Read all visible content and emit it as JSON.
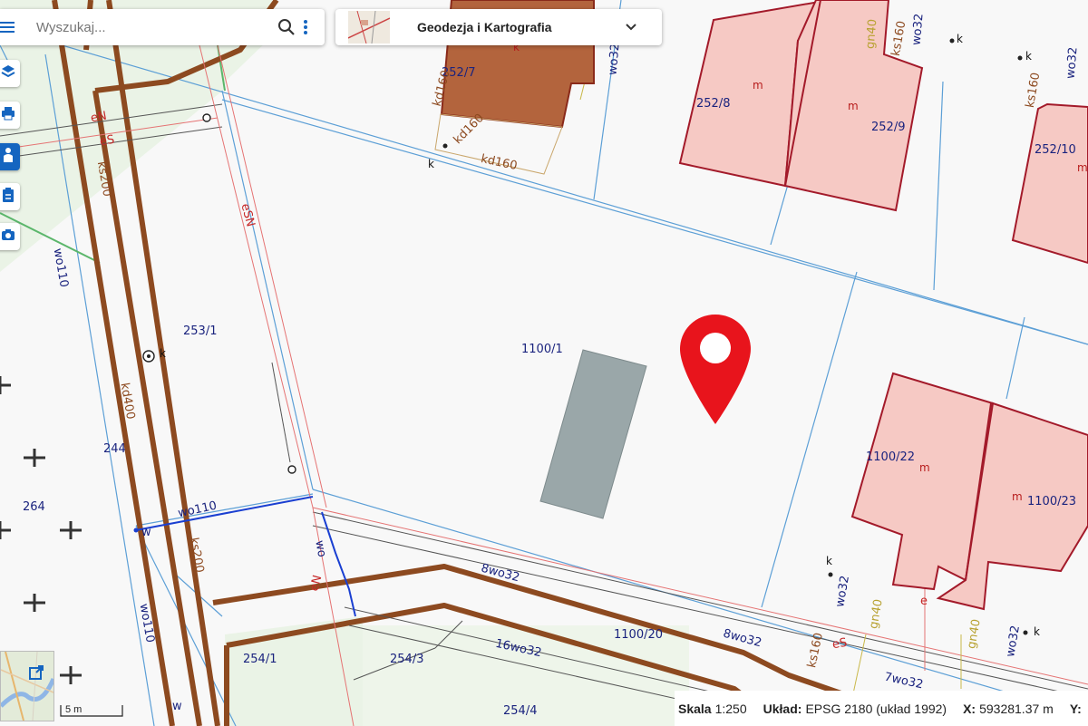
{
  "search": {
    "placeholder": "Wyszukaj..."
  },
  "layer": {
    "title": "Geodezja i Kartografia"
  },
  "status_bar": {
    "scale_label": "Skala",
    "scale_value": "1:250",
    "crs_label": "Układ:",
    "crs_value": "EPSG 2180 (układ 1992)",
    "x_label": "X:",
    "x_value": "593281.37 m",
    "y_label": "Y:"
  },
  "scale_bar": {
    "label": "5 m"
  },
  "map": {
    "parcels": [
      "252/7",
      "252/8",
      "252/9",
      "252/10",
      "253/1",
      "1100/1",
      "244",
      "264",
      "1100/22",
      "1100/23",
      "1100/20",
      "254/1",
      "254/3",
      "254/4"
    ],
    "building_codes": [
      "k",
      "m",
      "m",
      "m",
      "m",
      "m"
    ],
    "utility_labels": [
      "kd160",
      "kd160",
      "kd160",
      "ks160",
      "ks160",
      "ks160",
      "ks200",
      "ks200",
      "kd400",
      "wo110",
      "wo110",
      "wo110",
      "wo32",
      "wo32",
      "wo32",
      "wo32",
      "wo32",
      "8wo32",
      "8wo32",
      "16wo32",
      "7wo32",
      "gn40",
      "gn40",
      "gn40",
      "eS",
      "eS",
      "eSN",
      "eN",
      "eN",
      "e",
      "w",
      "w",
      "wo",
      "k",
      "k",
      "k",
      "k",
      "k",
      "k"
    ]
  },
  "icons": [
    "menu-icon",
    "search-icon",
    "more-icon",
    "chevron-down-icon",
    "layers-icon",
    "print-icon",
    "measure-icon",
    "clipboard-icon",
    "camera-icon",
    "external-link-icon",
    "location-pin-icon"
  ],
  "colors": {
    "accent": "#1565c0",
    "pin": "#e8141c",
    "building": "#f6c9c4",
    "building_border": "#a31a2a",
    "building_dark": "#c0683e",
    "pipe": "#8d4a20",
    "parcel_line": "#5c9fd6"
  }
}
